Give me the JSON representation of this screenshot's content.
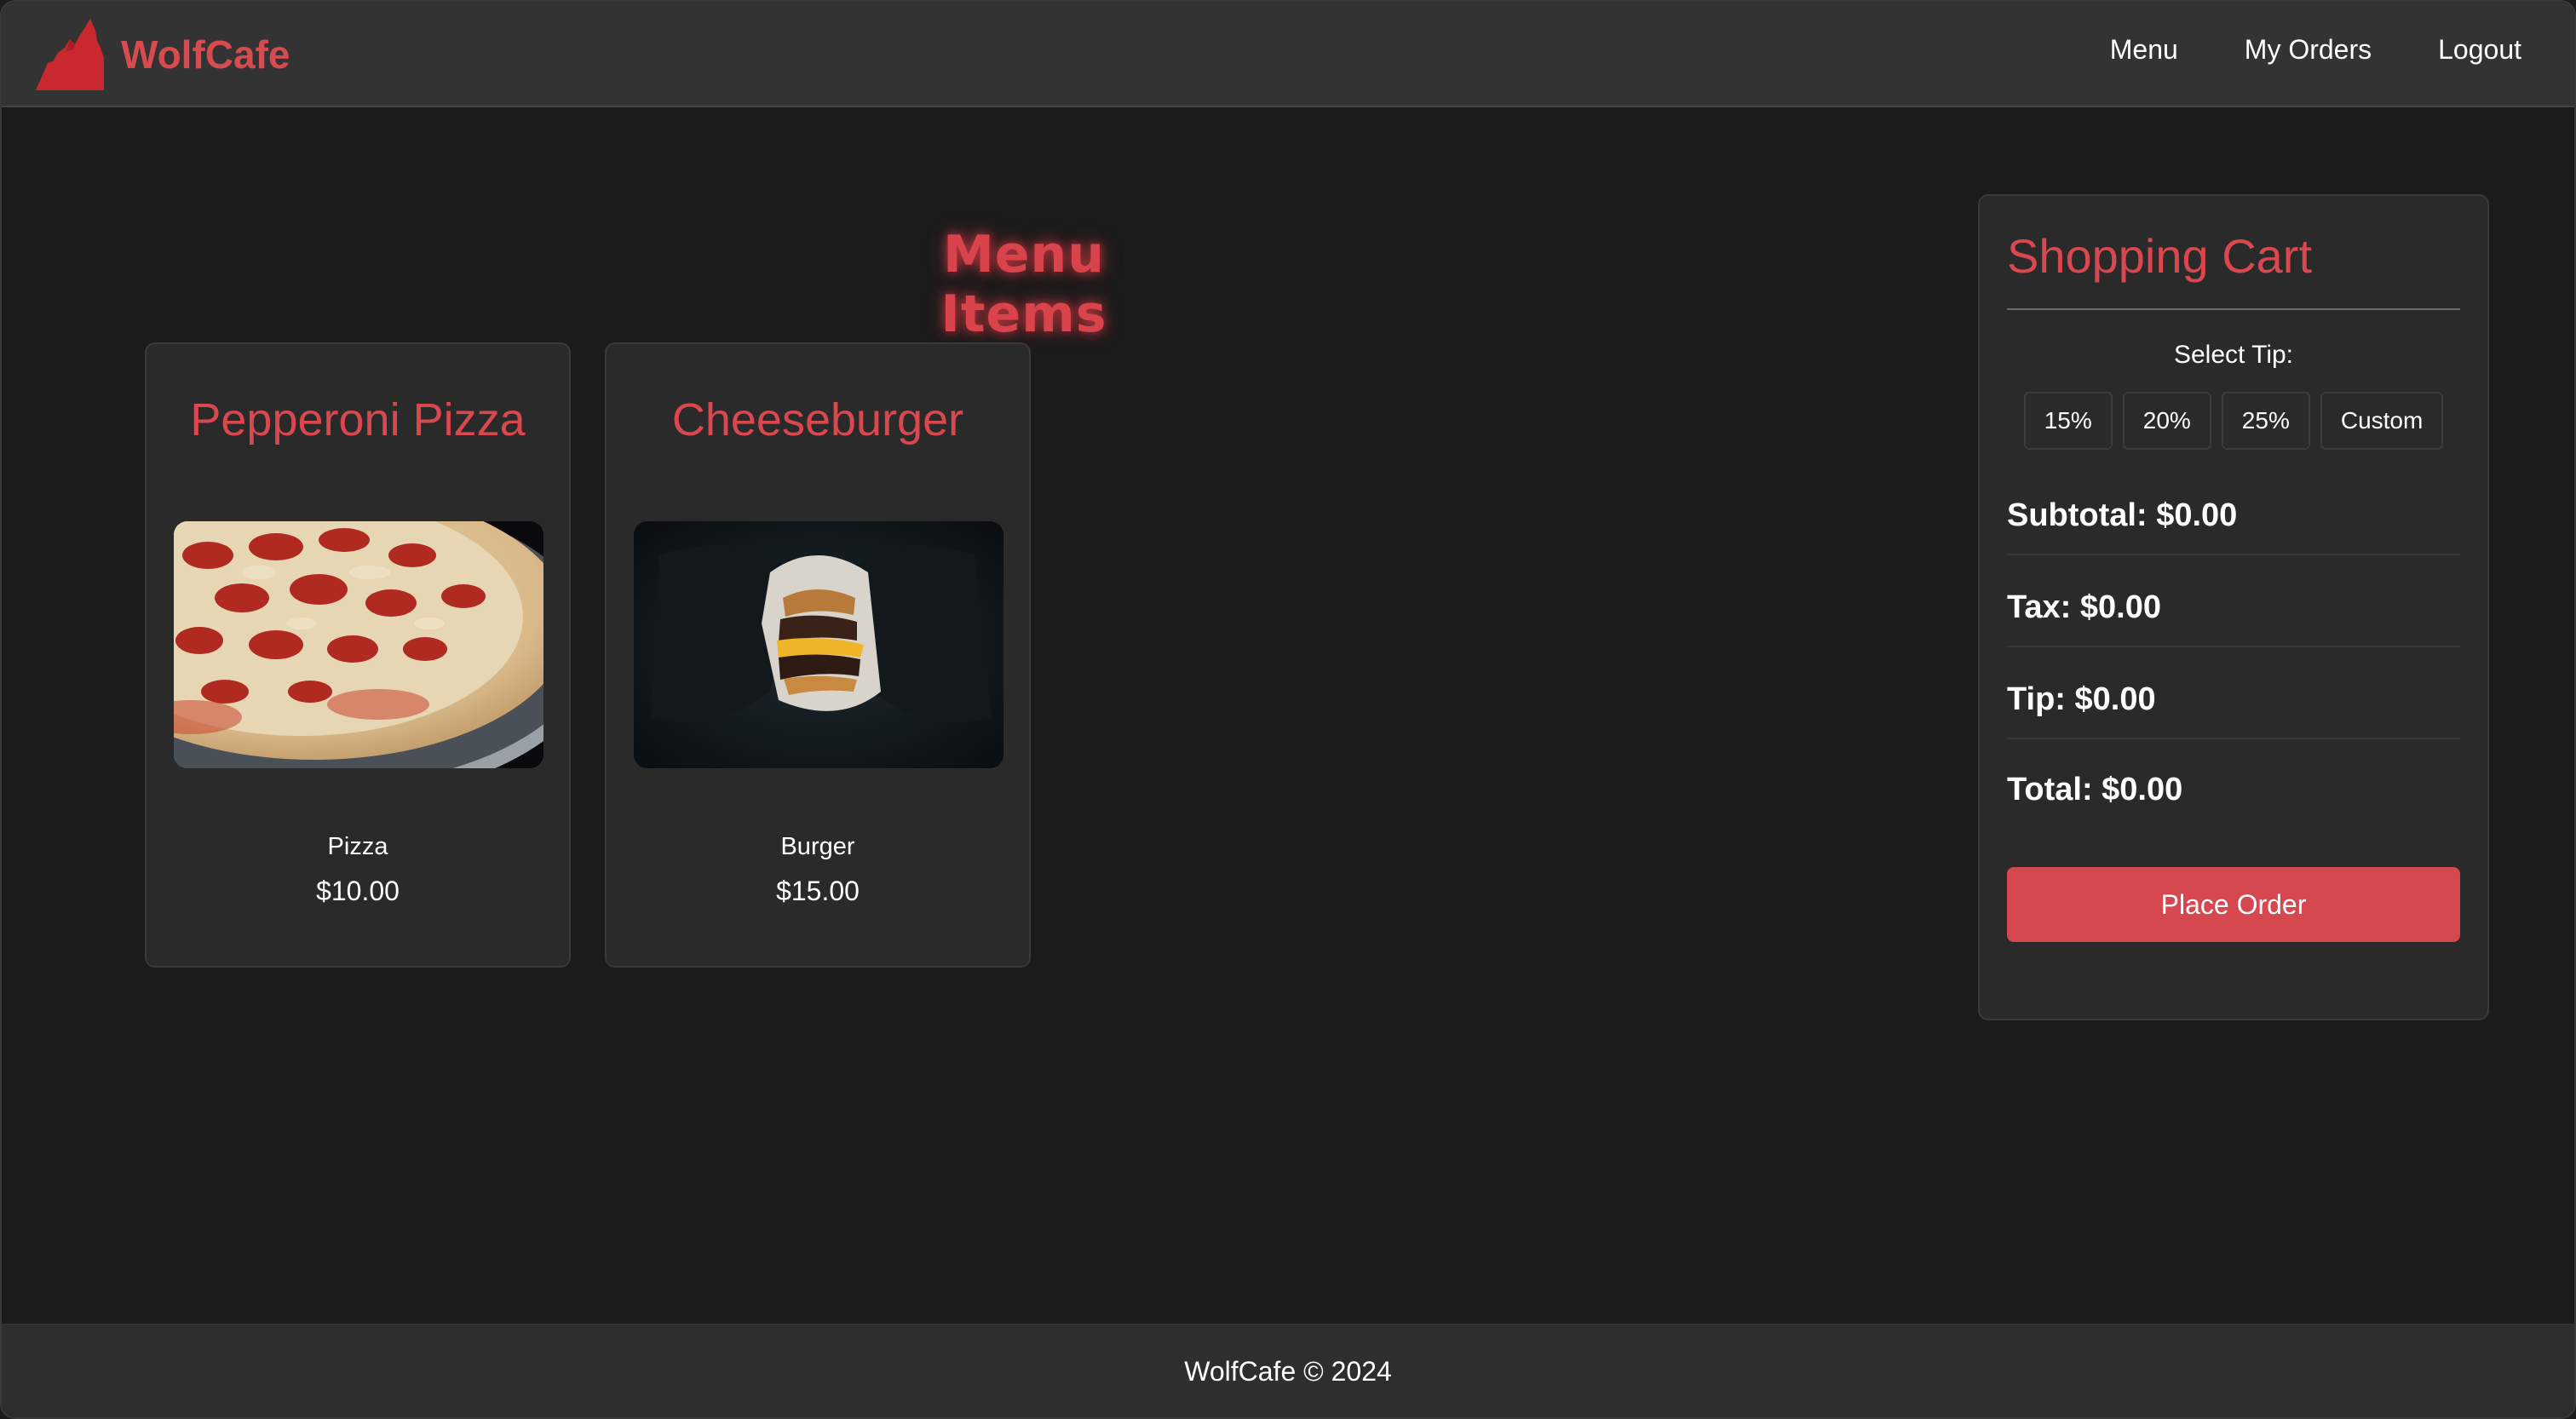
{
  "brand": {
    "name": "WolfCafe",
    "logo_icon": "wolf-howling-icon",
    "accent_color": "#d64a50"
  },
  "nav": {
    "items": [
      {
        "label": "Menu"
      },
      {
        "label": "My Orders"
      },
      {
        "label": "Logout"
      }
    ]
  },
  "menu": {
    "title": "Menu Items",
    "items": [
      {
        "name": "Pepperoni Pizza",
        "type": "Pizza",
        "price": "$10.00",
        "image": "pepperoni-pizza-photo"
      },
      {
        "name": "Cheeseburger",
        "type": "Burger",
        "price": "$15.00",
        "image": "cheeseburger-photo"
      }
    ]
  },
  "cart": {
    "title": "Shopping Cart",
    "tip_label": "Select Tip:",
    "tip_options": [
      {
        "label": "15%"
      },
      {
        "label": "20%"
      },
      {
        "label": "25%"
      },
      {
        "label": "Custom"
      }
    ],
    "subtotal": "Subtotal: $0.00",
    "tax": "Tax: $0.00",
    "tip": "Tip: $0.00",
    "total": "Total: $0.00",
    "place_order_label": "Place Order",
    "button_color": "#d5484f"
  },
  "footer": {
    "text": "WolfCafe © 2024"
  }
}
